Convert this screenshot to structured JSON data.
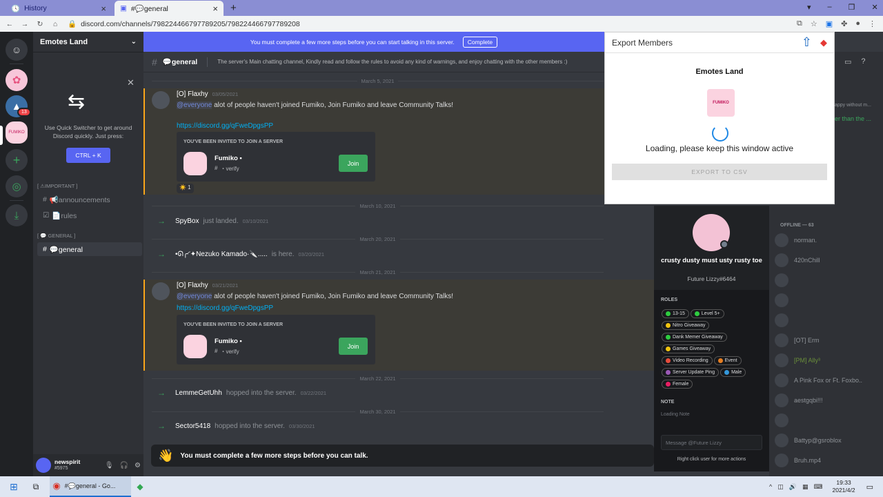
{
  "browser": {
    "tabs": [
      {
        "title": "History"
      },
      {
        "title": "#💬general"
      }
    ],
    "url": "discord.com/channels/798224466797789205/798224466797789208",
    "new_tab": "+"
  },
  "banner": {
    "text": "You must complete a few more steps before you can start talking in this server.",
    "button": "Complete"
  },
  "server": {
    "name": "Emotes Land",
    "badge": "13"
  },
  "switcher": {
    "text1": "Use Quick Switcher to get around",
    "text2": "Discord quickly. Just press:",
    "shortcut": "CTRL + K"
  },
  "categories": [
    {
      "label": "[ ⚠IMPORTANT ]"
    },
    {
      "label": "[ 💬 GENERAL ]"
    }
  ],
  "channels": [
    {
      "label": "📢announcements"
    },
    {
      "label": "📄rules"
    },
    {
      "label": "💬general"
    }
  ],
  "header": {
    "channel": "💬general",
    "topic": "The server's Main chatting channel, Kindly read and follow the rules to avoid any kind of warnings, and enjoy chatting with the other members :)"
  },
  "dates": [
    "March 5, 2021",
    "March 10, 2021",
    "March 20, 2021",
    "March 21, 2021",
    "March 22, 2021",
    "March 30, 2021"
  ],
  "messages": [
    {
      "user": "[O] Flaxhy",
      "time": "03/05/2021",
      "mention": "@everyone",
      "text": "alot of people haven't joined Fumiko, Join Fumiko and leave Community Talks!",
      "link": "https://discord.gg/qFweDpgsPP",
      "invite_title": "YOU'VE BEEN INVITED TO JOIN A SERVER",
      "invite_server": "Fumiko ▪",
      "invite_channel": "・verify",
      "join": "Join",
      "reaction": "☀️ 1"
    },
    {
      "user": "[O] Flaxhy",
      "time": "03/21/2021",
      "mention": "@everyone",
      "text": "alot of people haven't joined Fumiko, Join Fumiko and leave Community Talks!",
      "link": "https://discord.gg/qFweDpgsPP",
      "invite_title": "YOU'VE BEEN INVITED TO JOIN A SERVER",
      "invite_server": "Fumiko ▪",
      "invite_channel": "・verify",
      "join": "Join"
    }
  ],
  "system": [
    {
      "user": "SpyBox",
      "action": "just landed.",
      "time": "03/10/2021"
    },
    {
      "user": "•ᘏ╭◜✦Nezuko Kamado·ٛ🔪.....",
      "action": "is here.",
      "time": "03/20/2021"
    },
    {
      "user": "LemmeGetUhh",
      "action": "hopped into the server.",
      "time": "03/22/2021"
    },
    {
      "user": "Sector5418",
      "action": "hopped into the server.",
      "time": "03/30/2021"
    }
  ],
  "bottom_bar": {
    "text": "You must complete a few more steps before you can talk."
  },
  "user": {
    "name": "newspirit",
    "tag": "#5975"
  },
  "popup": {
    "title": "Export Members",
    "server": "Emotes Land",
    "server_icon_text": "FUMIKO",
    "loading": "Loading, please keep this window active",
    "button": "EXPORT TO CSV"
  },
  "profile": {
    "name": "crusty dusty must usty rusty toe",
    "tag": "Future Lizzy#6464",
    "roles_label": "ROLES",
    "note_label": "NOTE",
    "note": "Loading Note",
    "message_placeholder": "Message @Future Lizzy",
    "hint": "Right click user for more actions",
    "roles": [
      {
        "name": "13-15",
        "color": "#2ecc40"
      },
      {
        "name": "Level 5+",
        "color": "#2ecc40"
      },
      {
        "name": "Nitro Giveaway",
        "color": "#f1c40f"
      },
      {
        "name": "Dank Memer Giveaway",
        "color": "#2ecc40"
      },
      {
        "name": "Games Giveaway",
        "color": "#f1c40f"
      },
      {
        "name": "Video Recording",
        "color": "#e74c3c"
      },
      {
        "name": "Event",
        "color": "#e67e22"
      },
      {
        "name": "Server Update Ping",
        "color": "#9b59b6"
      },
      {
        "name": "Male",
        "color": "#3498db"
      },
      {
        "name": "Female",
        "color": "#e91e63"
      }
    ]
  },
  "members": {
    "offline_label": "OFFLINE — 63",
    "list": [
      "norman.",
      "420nChill",
      "",
      "",
      "",
      "[OT] Erm",
      "[PM] Ally³",
      "A Pink Fox or Ft. Foxbo..",
      "aestgqbi!!!",
      "",
      "Battyp@gsroblox",
      "Bruh.mp4"
    ]
  },
  "right_partial": [
    "appy without m...",
    "er than the ..."
  ],
  "taskbar": {
    "app": "#💬general - Go...",
    "time": "19:33",
    "date": "2021/4/2"
  }
}
